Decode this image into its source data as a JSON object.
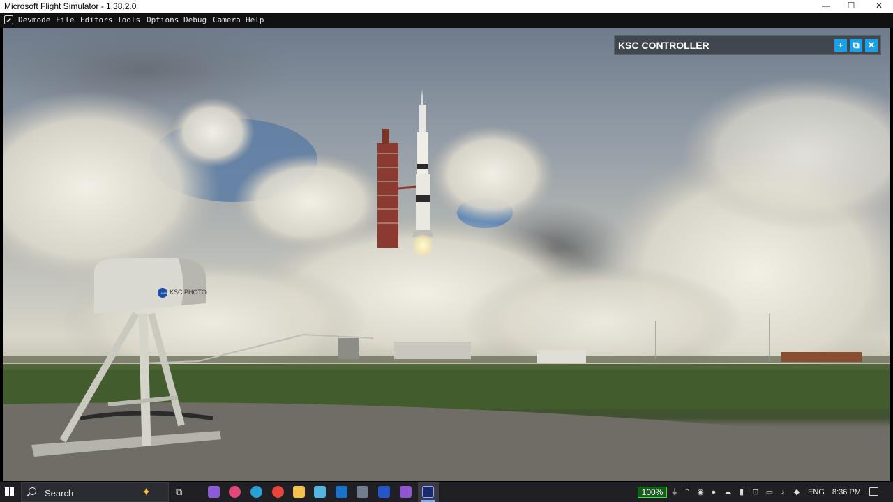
{
  "window": {
    "title": "Microsoft Flight Simulator - 1.38.2.0",
    "controls": {
      "minimize": "—",
      "maximize": "☐",
      "close": "✕"
    }
  },
  "menubar": {
    "items": [
      "Devmode",
      "File",
      "Editors",
      "Tools",
      "Options",
      "Debug",
      "Camera",
      "Help"
    ]
  },
  "viewport": {
    "scene": {
      "camera_box_label": "KSC PHOTO",
      "logo_text": "NASA"
    }
  },
  "ksc_panel": {
    "title": "KSC CONTROLLER",
    "buttons": {
      "add": "+",
      "popout": "⧉",
      "close": "✕"
    },
    "accent": "#1aa0e8"
  },
  "taskbar": {
    "search_label": "Search",
    "apps": [
      {
        "name": "visual-studio-purple-icon",
        "color": "#8a5cd6"
      },
      {
        "name": "copilot-icon",
        "color": "#e2477a"
      },
      {
        "name": "edge-icon",
        "color": "#2aa0d6"
      },
      {
        "name": "chrome-icon",
        "color": "#e8453c"
      },
      {
        "name": "file-explorer-icon",
        "color": "#f2c14e"
      },
      {
        "name": "app-icon",
        "color": "#53b5e0"
      },
      {
        "name": "outlook-icon",
        "color": "#1a73c9"
      },
      {
        "name": "calculator-icon",
        "color": "#6f7d8c"
      },
      {
        "name": "l-app-icon",
        "color": "#2457c5"
      },
      {
        "name": "visual-studio-icon",
        "color": "#8f56d0"
      }
    ],
    "tray": {
      "battery": "100%",
      "language": "ENG",
      "clock": "8:36 PM"
    }
  }
}
